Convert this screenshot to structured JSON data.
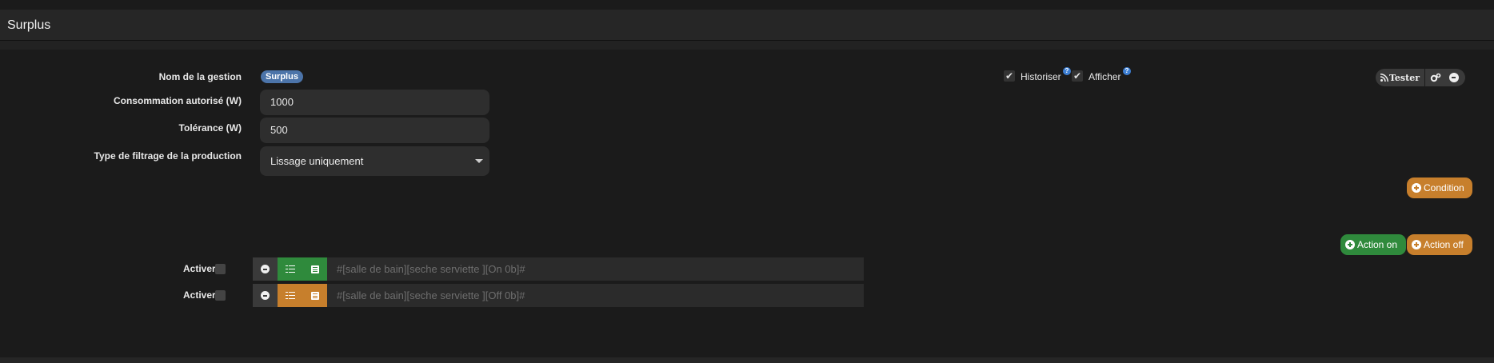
{
  "panel": {
    "title": "Surplus"
  },
  "form": {
    "name_label": "Nom de la gestion",
    "name_value": "Surplus",
    "consumption_label": "Consommation autorisé (W)",
    "consumption_value": "1000",
    "tolerance_label": "Tolérance (W)",
    "tolerance_value": "500",
    "filter_label": "Type de filtrage de la production",
    "filter_value": "Lissage uniquement"
  },
  "options": {
    "historiser_label": "Historiser",
    "afficher_label": "Afficher",
    "historiser_checked": true,
    "afficher_checked": true
  },
  "toolbar": {
    "test_label": "Tester"
  },
  "buttons": {
    "condition_label": "Condition",
    "action_on_label": "Action on",
    "action_off_label": "Action off"
  },
  "actions": [
    {
      "activate_label": "Activer",
      "command": "#[salle de bain][seche serviette ][On 0b]#",
      "accent": "#2f8a3c"
    },
    {
      "activate_label": "Activer",
      "command": "#[salle de bain][seche serviette ][Off 0b]#",
      "accent": "#c77f2c"
    }
  ],
  "colors": {
    "background": "#1b1b1b",
    "badge": "#4c74a9",
    "orange": "#c77f2c",
    "green": "#2f8a3c",
    "help": "#3d7fd4"
  }
}
